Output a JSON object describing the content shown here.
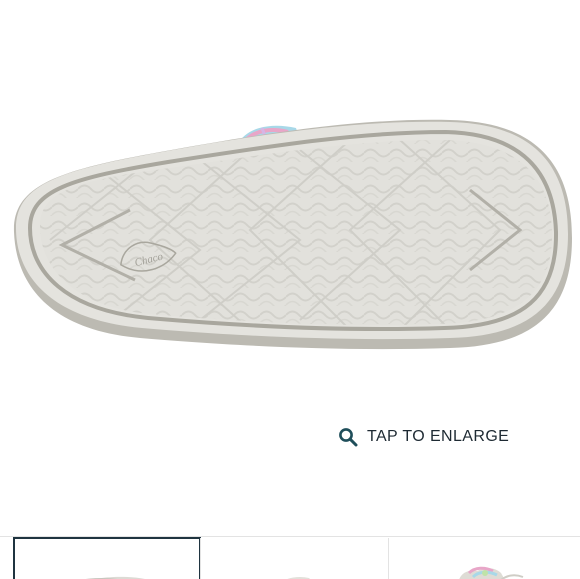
{
  "product_gallery": {
    "main_image": {
      "alt": "",
      "sole_logo_text": "Chaco"
    },
    "enlarge": {
      "icon": "search-icon",
      "label": "TAP TO ENLARGE",
      "icon_color": "#1f4e5a"
    },
    "thumbnails": [
      {
        "selected": true
      },
      {
        "selected": false
      },
      {
        "selected": false
      }
    ],
    "colors": {
      "accent": "#1f3440",
      "sole": "#e2e1dc",
      "sole_edge": "#b9b7ae"
    }
  }
}
